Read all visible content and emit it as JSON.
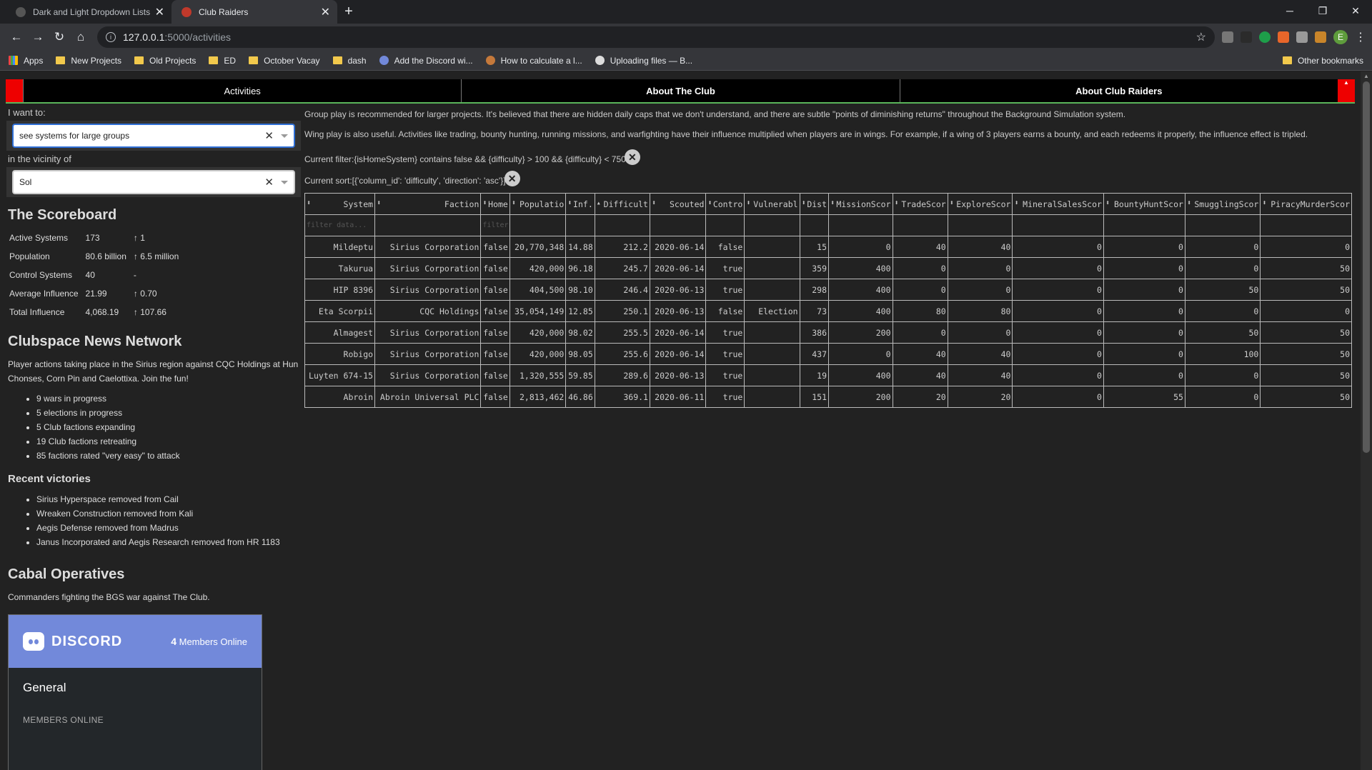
{
  "browser": {
    "tabs": [
      {
        "title": "Dark and Light Dropdown Lists |",
        "active": false,
        "color": "#555555"
      },
      {
        "title": "Club Raiders",
        "active": true,
        "color": "#c0392b"
      }
    ],
    "url_host": "127.0.0.1",
    "url_path": ":5000/activities",
    "bookmarks": [
      {
        "label": "Apps",
        "type": "apps"
      },
      {
        "label": "New Projects",
        "type": "folder"
      },
      {
        "label": "Old Projects",
        "type": "folder"
      },
      {
        "label": "ED",
        "type": "folder"
      },
      {
        "label": "October Vacay",
        "type": "folder"
      },
      {
        "label": "dash",
        "type": "folder"
      },
      {
        "label": "Add the Discord wi...",
        "type": "discord"
      },
      {
        "label": "How to calculate a l...",
        "type": "site"
      },
      {
        "label": "Uploading files — B...",
        "type": "site"
      }
    ],
    "other_bookmarks": "Other bookmarks",
    "profile_initial": "E"
  },
  "nav": {
    "tabs": [
      "Activities",
      "About The Club",
      "About Club Raiders"
    ]
  },
  "sidebar": {
    "want_label": "I want to:",
    "want_value": "see systems for large groups",
    "vicinity_label": "in the vicinity of",
    "vicinity_value": "Sol",
    "scoreboard_title": "The Scoreboard",
    "scoreboard": [
      {
        "label": "Active Systems",
        "value": "173",
        "delta": "↑ 1"
      },
      {
        "label": "Population",
        "value": "80.6 billion",
        "delta": "↑ 6.5 million"
      },
      {
        "label": "Control Systems",
        "value": "40",
        "delta": "-"
      },
      {
        "label": "Average Influence",
        "value": "21.99",
        "delta": "↑ 0.70"
      },
      {
        "label": "Total Influence",
        "value": "4,068.19",
        "delta": "↑ 107.66"
      }
    ],
    "news_title": "Clubspace News Network",
    "news_text": "Player actions taking place in the Sirius region against CQC Holdings at Hun Chonses, Corn Pin and Caelottixa. Join the fun!",
    "news_items": [
      "9 wars in progress",
      "5 elections in progress",
      "5 Club factions expanding",
      "19 Club factions retreating",
      "85 factions rated \"very easy\" to attack"
    ],
    "victories_title": "Recent victories",
    "victories": [
      "Sirius Hyperspace removed from Cail",
      "Wreaken Construction removed from Kali",
      "Aegis Defense removed from Madrus",
      "Janus Incorporated and Aegis Research removed from HR 1183"
    ],
    "cabal_title": "Cabal Operatives",
    "cabal_text": "Commanders fighting the BGS war against The Club.",
    "discord": {
      "brand": "DISCORD",
      "count": "4",
      "count_label": "Members Online",
      "channel": "General",
      "members_label": "MEMBERS ONLINE"
    }
  },
  "main": {
    "para1": "Group play is recommended for larger projects. It's believed that there are hidden daily caps that we don't understand, and there are subtle \"points of diminishing returns\" throughout the Background Simulation system.",
    "para2": "Wing play is also useful. Activities like trading, bounty hunting, running missions, and warfighting have their influence multiplied when players are in wings. For example, if a wing of 3 players earns a bounty, and each redeems it properly, the influence effect is tripled.",
    "filter": "Current filter:{isHomeSystem} contains false && {difficulty} > 100 && {difficulty} < 750",
    "sort": "Current sort:[{'column_id': 'difficulty', 'direction': 'asc'}]",
    "filter_placeholder": "filter data...",
    "columns": [
      "System",
      "Faction",
      "Home",
      "Populatio",
      "Inf.",
      "Difficult",
      "Scouted",
      "Contro",
      "Vulnerabl",
      "Dist",
      "MissionScor",
      "TradeScor",
      "ExploreScor",
      "MineralSalesScor",
      "BountyHuntScor",
      "SmugglingScor",
      "PiracyMurderScor"
    ],
    "rows": [
      [
        "Mildeptu",
        "Sirius Corporation",
        "false",
        "20,770,348",
        "14.88",
        "212.2",
        "2020-06-14",
        "false",
        "",
        "15",
        "0",
        "40",
        "40",
        "0",
        "0",
        "0",
        "0"
      ],
      [
        "Takurua",
        "Sirius Corporation",
        "false",
        "420,000",
        "96.18",
        "245.7",
        "2020-06-14",
        "true",
        "",
        "359",
        "400",
        "0",
        "0",
        "0",
        "0",
        "0",
        "50"
      ],
      [
        "HIP 8396",
        "Sirius Corporation",
        "false",
        "404,500",
        "98.10",
        "246.4",
        "2020-06-13",
        "true",
        "",
        "298",
        "400",
        "0",
        "0",
        "0",
        "0",
        "50",
        "50"
      ],
      [
        "Eta Scorpii",
        "CQC Holdings",
        "false",
        "35,054,149",
        "12.85",
        "250.1",
        "2020-06-13",
        "false",
        "Election",
        "73",
        "400",
        "80",
        "80",
        "0",
        "0",
        "0",
        "0"
      ],
      [
        "Almagest",
        "Sirius Corporation",
        "false",
        "420,000",
        "98.02",
        "255.5",
        "2020-06-14",
        "true",
        "",
        "386",
        "200",
        "0",
        "0",
        "0",
        "0",
        "50",
        "50"
      ],
      [
        "Robigo",
        "Sirius Corporation",
        "false",
        "420,000",
        "98.05",
        "255.6",
        "2020-06-14",
        "true",
        "",
        "437",
        "0",
        "40",
        "40",
        "0",
        "0",
        "100",
        "50"
      ],
      [
        "Luyten 674-15",
        "Sirius Corporation",
        "false",
        "1,320,555",
        "59.85",
        "289.6",
        "2020-06-13",
        "true",
        "",
        "19",
        "400",
        "40",
        "40",
        "0",
        "0",
        "0",
        "50"
      ],
      [
        "Abroin",
        "Abroin Universal PLC",
        "false",
        "2,813,462",
        "46.86",
        "369.1",
        "2020-06-11",
        "true",
        "",
        "151",
        "200",
        "20",
        "20",
        "0",
        "55",
        "0",
        "50"
      ]
    ]
  }
}
